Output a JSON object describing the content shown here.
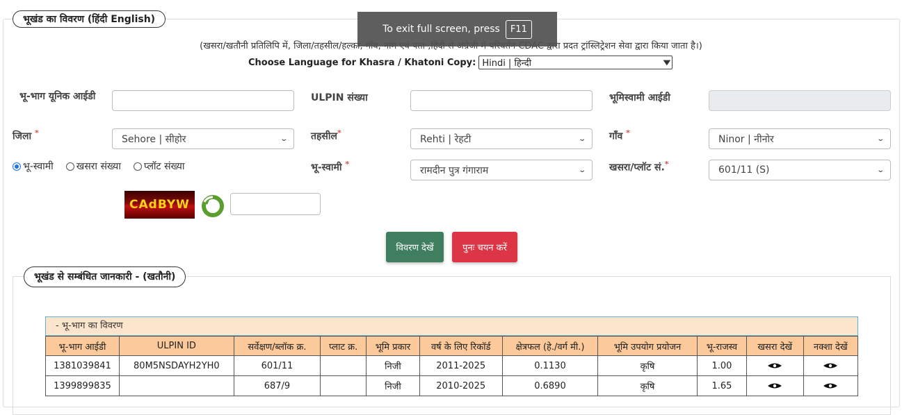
{
  "main_legend": "भूखंड का विवरण  (हिंदी  English)",
  "toast": {
    "text": "To exit full screen, press",
    "key": "F11"
  },
  "note": "(खसरा/खतौनी प्रतिलिपि में, जिला/तहसील/हल्का, गाँव, नाम एवं पता ,हिंदी से अंग्रेजी में परिवर्तन CDAC द्वारा प्रदत ट्रांस्लिट्रेशन सेवा द्वारा किया जाता है।)",
  "language": {
    "label": "Choose Language for Khasra / Khatoni Copy:",
    "selected": "Hindi | हिन्दी"
  },
  "fields": {
    "unique_id": {
      "label": "भू-भाग      यूनिक आईडी",
      "value": ""
    },
    "ulpin": {
      "label": "ULPIN संख्या",
      "value": ""
    },
    "owner_id": {
      "label": "भूमिस्वामी आईडी",
      "value": ""
    },
    "district": {
      "label": "जिला",
      "required": "*",
      "selected": "Sehore | सीहोर"
    },
    "tehsil": {
      "label": "तहसील",
      "required": "*",
      "selected": "Rehti | रेहटी"
    },
    "village": {
      "label": "गाँव",
      "required": "*",
      "selected": "Ninor | नीनोर"
    },
    "owner": {
      "label": "भू-स्वामी",
      "required": "*",
      "selected": "रामदीन पुत्र गंगाराम"
    },
    "khasra": {
      "label": "खसरा/प्लॉट सं.",
      "required": "*",
      "selected": "601/11 (S)"
    }
  },
  "search_type": [
    {
      "label": "भू-स्वामी",
      "checked": true
    },
    {
      "label": "खसरा संख्या",
      "checked": false
    },
    {
      "label": "प्लॉट संख्या",
      "checked": false
    }
  ],
  "captcha": {
    "text": "CAdBYW",
    "input_value": ""
  },
  "buttons": {
    "view": "विवरण देखें",
    "reset": "पुनः चयन करें"
  },
  "colors": {
    "view_btn": "#3f7f5f",
    "reset_btn": "#dc3545",
    "table_header": "#fbc99a",
    "caption_bg": "#fde4cc"
  },
  "section_legend": "भूखंड से सम्बंधित जानकारी -   (खतौनी)",
  "table": {
    "caption": "- भू-भाग का विवरण",
    "headers": [
      "भू-भाग आईडी",
      "ULPIN ID",
      "सर्वेक्षण/ब्लॉक क्र.",
      "प्लाट क्र.",
      "भूमि प्रकार",
      "वर्ष के लिए रिकॉर्ड",
      "क्षेत्रफल (हे./वर्ग मी.)",
      "भूमि उपयोग प्रयोजन",
      "भू-राजस्व",
      "खसरा देखें",
      "नक्शा देखें"
    ],
    "rows": [
      [
        "1381039841",
        "80M5NSDAYH2YH0",
        "601/11",
        "",
        "निजी",
        "2011-2025",
        "0.1130",
        "कृषि",
        "1.00",
        "eye-icon",
        "eye-icon"
      ],
      [
        "1399899835",
        "",
        "687/9",
        "",
        "निजी",
        "2010-2025",
        "0.6890",
        "कृषि",
        "1.65",
        "eye-icon",
        "eye-icon"
      ]
    ]
  }
}
